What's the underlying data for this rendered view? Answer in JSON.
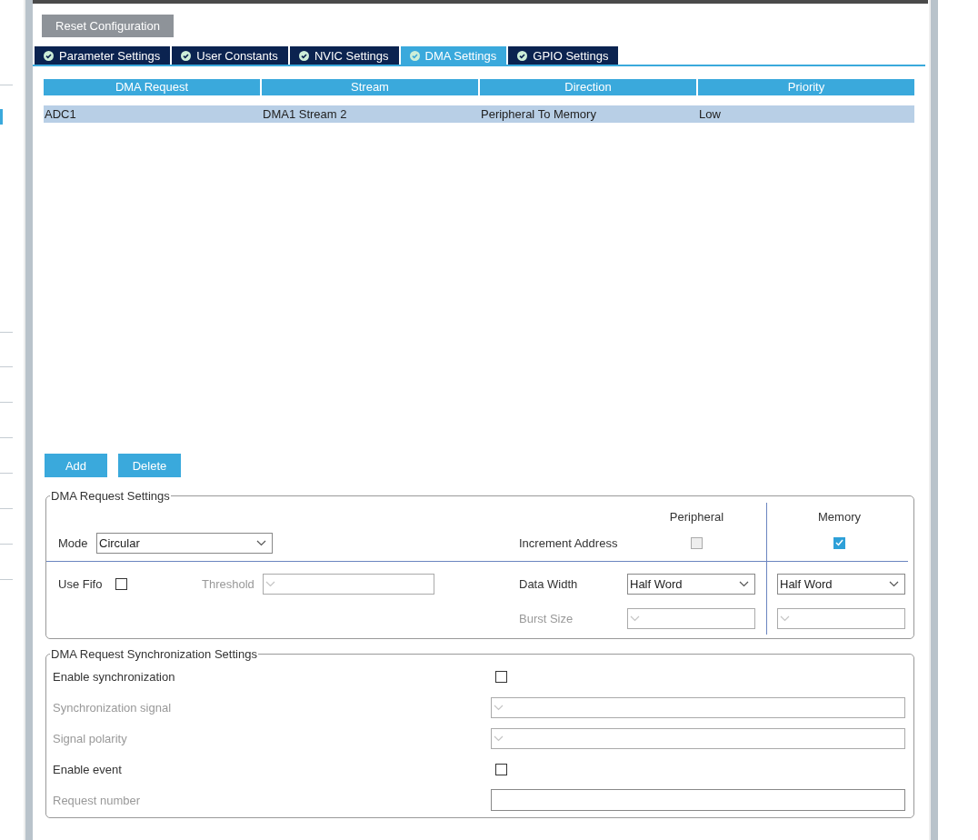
{
  "reset_button": "Reset Configuration",
  "tabs": [
    {
      "label": "Parameter Settings",
      "selected": false
    },
    {
      "label": "User Constants",
      "selected": false
    },
    {
      "label": "NVIC Settings",
      "selected": false
    },
    {
      "label": "DMA Settings",
      "selected": true
    },
    {
      "label": "GPIO Settings",
      "selected": false
    }
  ],
  "dma_table": {
    "columns": [
      "DMA Request",
      "Stream",
      "Direction",
      "Priority"
    ],
    "rows": [
      {
        "cells": [
          "ADC1",
          "DMA1 Stream 2",
          "Peripheral To Memory",
          "Low"
        ],
        "selected": true
      }
    ]
  },
  "buttons": [
    "Add",
    "Delete"
  ],
  "request_settings": {
    "title": "DMA Request Settings",
    "peripheral_header": "Peripheral",
    "memory_header": "Memory",
    "mode": {
      "label": "Mode",
      "value": "Circular"
    },
    "increment_address": {
      "label": "Increment Address",
      "peripheral_checked": false,
      "peripheral_disabled": true,
      "memory_checked": true
    },
    "use_fifo": {
      "label": "Use Fifo",
      "checked": false
    },
    "threshold": {
      "label": "Threshold",
      "disabled": true
    },
    "data_width": {
      "label": "Data Width",
      "peripheral_value": "Half Word",
      "memory_value": "Half Word"
    },
    "burst_size": {
      "label": "Burst Size",
      "disabled": true
    }
  },
  "sync_settings": {
    "title": "DMA Request Synchronization Settings",
    "rows": [
      {
        "label": "Enable synchronization",
        "kind": "checkbox",
        "checked": false,
        "disabled": false
      },
      {
        "label": "Synchronization signal",
        "kind": "select",
        "disabled": true
      },
      {
        "label": "Signal polarity",
        "kind": "select",
        "disabled": true
      },
      {
        "label": "Enable event",
        "kind": "checkbox",
        "checked": false,
        "disabled": false
      },
      {
        "label": "Request number",
        "kind": "input",
        "disabled": true
      }
    ]
  }
}
